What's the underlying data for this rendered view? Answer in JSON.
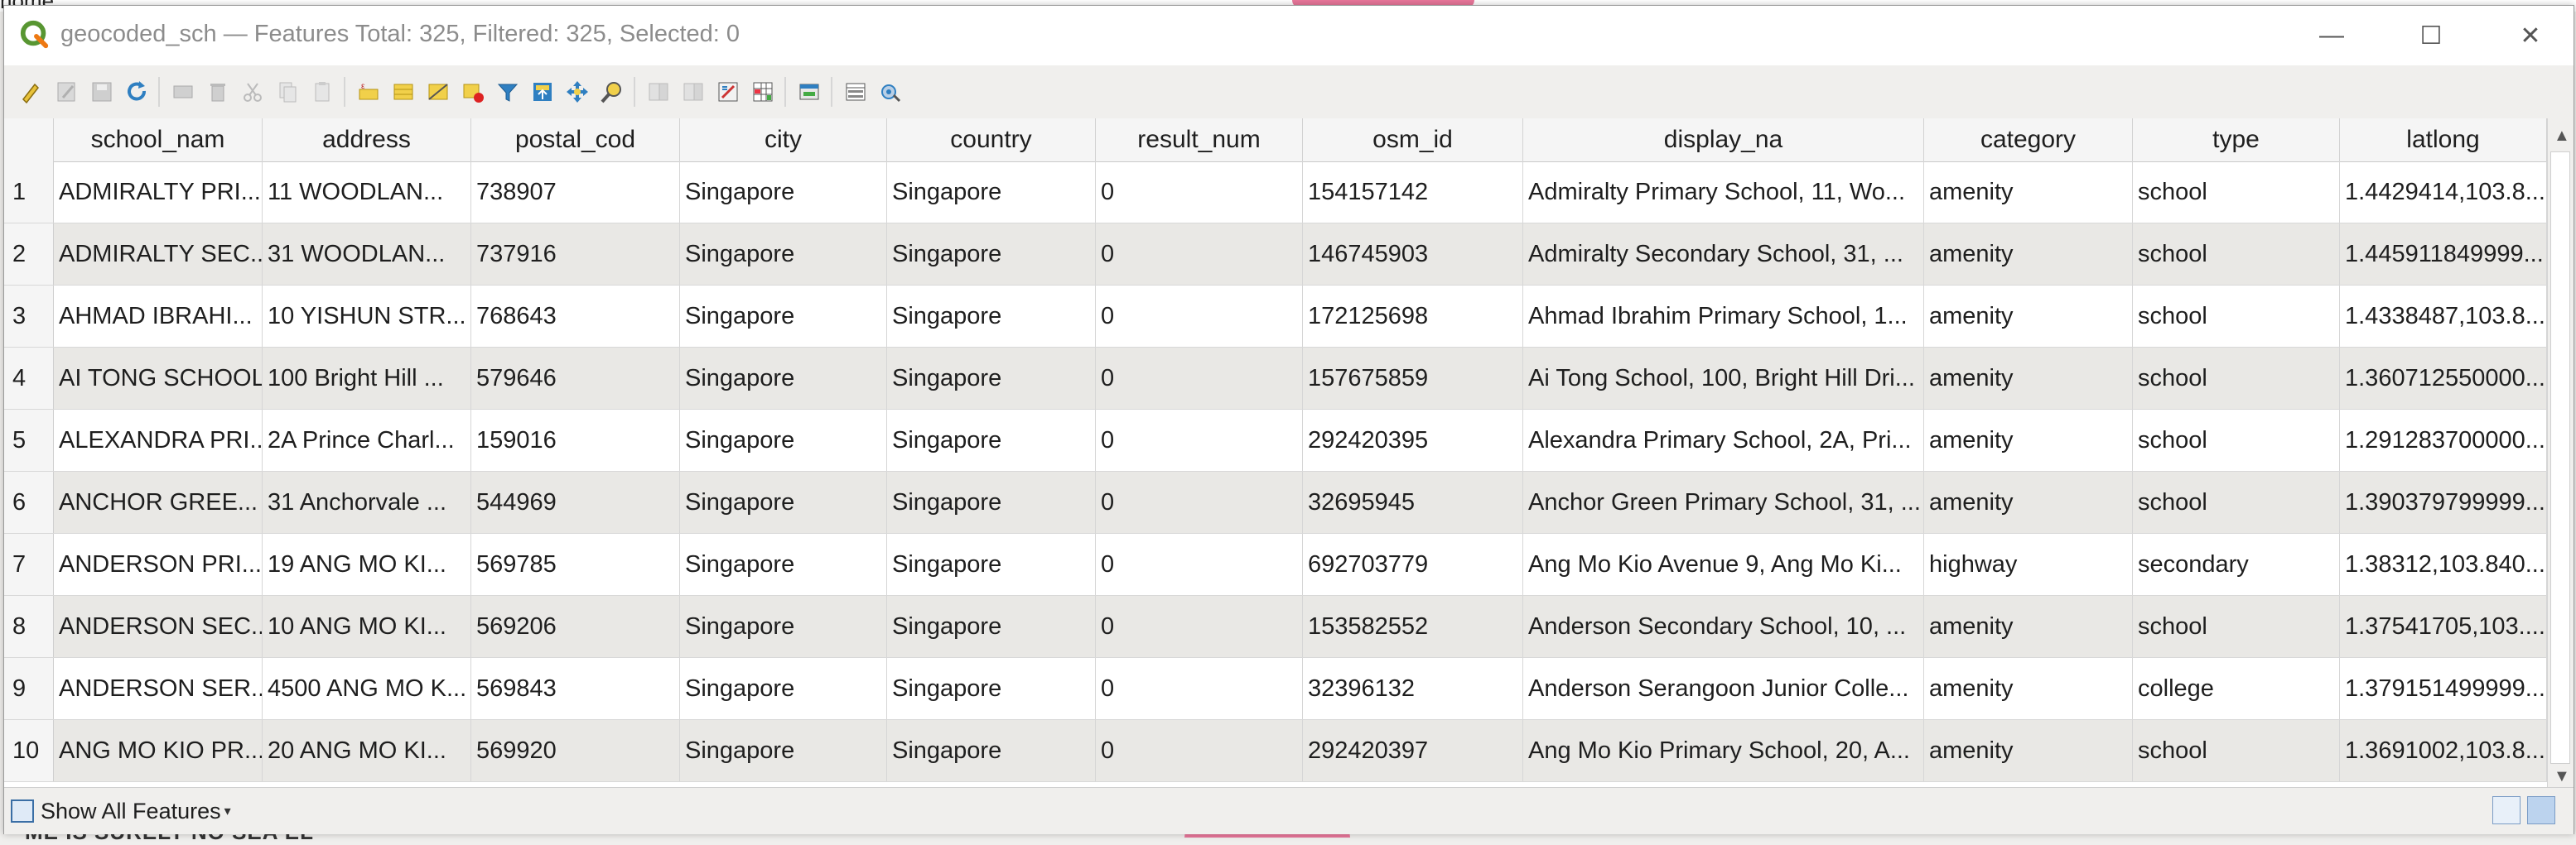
{
  "background": {
    "top_text": "home",
    "bottom_text": "ME IS SURELY NO SEA EL"
  },
  "window": {
    "title": "geocoded_sch — Features Total: 325, Filtered: 325, Selected: 0",
    "controls": {
      "minimize": "—",
      "maximize": "☐",
      "close": "✕"
    }
  },
  "toolbar": {
    "buttons": [
      "toggle-editing",
      "multi-edit",
      "save-edits",
      "reload",
      "add-feature",
      "delete-selected",
      "cut",
      "copy",
      "paste",
      "select-expression",
      "select-all",
      "invert-selection",
      "deselect-all",
      "filter-select",
      "move-selection-top",
      "pan-to-selected",
      "zoom-to-selected",
      "new-field",
      "delete-field",
      "field-calculator",
      "conditional-formatting",
      "dock-table",
      "actions"
    ]
  },
  "table": {
    "columns": [
      "school_nam",
      "address",
      "postal_cod",
      "city",
      "country",
      "result_num",
      "osm_id",
      "display_na",
      "category",
      "type",
      "latlong"
    ],
    "rows": [
      {
        "n": "1",
        "school_nam": "ADMIRALTY PRI...",
        "address": "11   WOODLAN...",
        "postal_cod": "738907",
        "city": "Singapore",
        "country": "Singapore",
        "result_num": "0",
        "osm_id": "154157142",
        "display_na": "Admiralty Primary School, 11, Wo...",
        "category": "amenity",
        "type": "school",
        "latlong": "1.4429414,103.8..."
      },
      {
        "n": "2",
        "school_nam": "ADMIRALTY SEC...",
        "address": "31   WOODLAN...",
        "postal_cod": "737916",
        "city": "Singapore",
        "country": "Singapore",
        "result_num": "0",
        "osm_id": "146745903",
        "display_na": "Admiralty Secondary School, 31, ...",
        "category": "amenity",
        "type": "school",
        "latlong": "1.445911849999..."
      },
      {
        "n": "3",
        "school_nam": "AHMAD IBRAHI...",
        "address": "10   YISHUN STR...",
        "postal_cod": "768643",
        "city": "Singapore",
        "country": "Singapore",
        "result_num": "0",
        "osm_id": "172125698",
        "display_na": "Ahmad Ibrahim Primary School, 1...",
        "category": "amenity",
        "type": "school",
        "latlong": "1.4338487,103.8..."
      },
      {
        "n": "4",
        "school_nam": "AI TONG SCHOOL",
        "address": "100  Bright Hill ...",
        "postal_cod": "579646",
        "city": "Singapore",
        "country": "Singapore",
        "result_num": "0",
        "osm_id": "157675859",
        "display_na": "Ai Tong School, 100, Bright Hill Dri...",
        "category": "amenity",
        "type": "school",
        "latlong": "1.360712550000..."
      },
      {
        "n": "5",
        "school_nam": "ALEXANDRA PRI...",
        "address": "2A   Prince Charl...",
        "postal_cod": "159016",
        "city": "Singapore",
        "country": "Singapore",
        "result_num": "0",
        "osm_id": "292420395",
        "display_na": "Alexandra Primary School, 2A, Pri...",
        "category": "amenity",
        "type": "school",
        "latlong": "1.291283700000..."
      },
      {
        "n": "6",
        "school_nam": "ANCHOR GREE...",
        "address": "31   Anchorvale ...",
        "postal_cod": "544969",
        "city": "Singapore",
        "country": "Singapore",
        "result_num": "0",
        "osm_id": "32695945",
        "display_na": "Anchor Green Primary School, 31, ...",
        "category": "amenity",
        "type": "school",
        "latlong": "1.390379799999..."
      },
      {
        "n": "7",
        "school_nam": "ANDERSON PRI...",
        "address": "19   ANG MO KI...",
        "postal_cod": "569785",
        "city": "Singapore",
        "country": "Singapore",
        "result_num": "0",
        "osm_id": "692703779",
        "display_na": "Ang Mo Kio Avenue 9, Ang Mo Ki...",
        "category": "highway",
        "type": "secondary",
        "latlong": "1.38312,103.840..."
      },
      {
        "n": "8",
        "school_nam": "ANDERSON SEC...",
        "address": "10   ANG MO KI...",
        "postal_cod": "569206",
        "city": "Singapore",
        "country": "Singapore",
        "result_num": "0",
        "osm_id": "153582552",
        "display_na": "Anderson Secondary School, 10, ...",
        "category": "amenity",
        "type": "school",
        "latlong": "1.37541705,103...."
      },
      {
        "n": "9",
        "school_nam": "ANDERSON SER...",
        "address": "4500 ANG MO K...",
        "postal_cod": "569843",
        "city": "Singapore",
        "country": "Singapore",
        "result_num": "0",
        "osm_id": "32396132",
        "display_na": "Anderson Serangoon Junior Colle...",
        "category": "amenity",
        "type": "college",
        "latlong": "1.379151499999..."
      },
      {
        "n": "10",
        "school_nam": "ANG MO KIO PR...",
        "address": "20   ANG MO KI...",
        "postal_cod": "569920",
        "city": "Singapore",
        "country": "Singapore",
        "result_num": "0",
        "osm_id": "292420397",
        "display_na": "Ang Mo Kio Primary School, 20, A...",
        "category": "amenity",
        "type": "school",
        "latlong": "1.3691002,103.8..."
      }
    ]
  },
  "bottom": {
    "filter_label": "Show All Features",
    "dropdown_arrow": "▾"
  }
}
